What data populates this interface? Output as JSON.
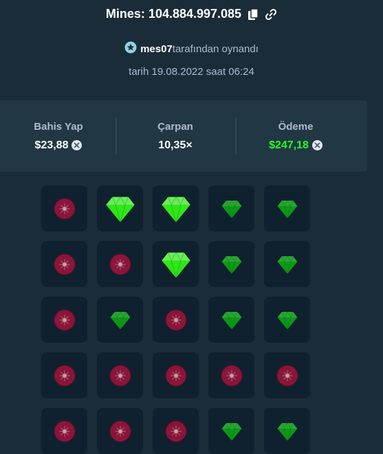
{
  "header": {
    "title": "Mines: 104.884.997.085",
    "player_name": "mes07",
    "player_suffix": "tarafından oynandı",
    "date_line": "tarih 19.08.2022 saat 06:24"
  },
  "stats": {
    "bet_label": "Bahis Yap",
    "bet_value": "$23,88",
    "multiplier_label": "Çarpan",
    "multiplier_value": "10,35×",
    "payout_label": "Ödeme",
    "payout_value": "$247,18"
  },
  "icons": {
    "copy": "copy-icon",
    "link": "link-icon",
    "vip": "vip-star-icon",
    "currency": "currency-coin-icon",
    "gem": "gem-icon",
    "mine": "mine-icon"
  },
  "colors": {
    "background": "#1a2c38",
    "panel": "#213743",
    "tile": "#0f212e",
    "payout_green": "#1fff20",
    "gem_revealed": "#2ee818",
    "gem_unrevealed": "#0c9a16",
    "mine": "#8a1538"
  },
  "board": {
    "rows": [
      [
        "mine",
        "gem_revealed",
        "gem_revealed",
        "gem",
        "gem"
      ],
      [
        "mine",
        "mine",
        "gem_revealed",
        "gem",
        "gem"
      ],
      [
        "mine",
        "gem",
        "mine",
        "gem",
        "gem"
      ],
      [
        "mine",
        "mine",
        "mine",
        "mine",
        "mine"
      ],
      [
        "mine",
        "mine",
        "mine",
        "gem",
        "gem"
      ]
    ]
  }
}
